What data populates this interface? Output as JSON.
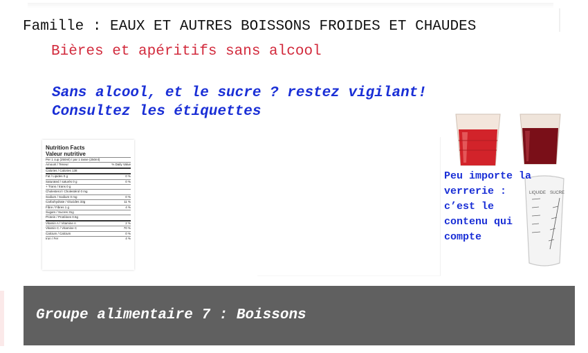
{
  "header": {
    "famille": "Famille : EAUX ET AUTRES BOISSONS FROIDES ET CHAUDES",
    "subtitle": "Bières et apéritifs sans alcool"
  },
  "warning": {
    "line1": "Sans alcool, et le sucre ? restez vigilant!",
    "line2": "Consultez les étiquettes"
  },
  "nutrition_label": {
    "title": "Nutrition Facts",
    "subtitle": "Valeur nutritive",
    "rows": [
      {
        "left": "Per 1 cup (250ml) / par 1 tasse (250ml)",
        "right": ""
      },
      {
        "left": "Amount / Teneur",
        "right": "% Daily Value"
      },
      {
        "left": "Calories / Calories 138",
        "right": ""
      },
      {
        "left": "Fat / Lipides 0 g",
        "right": "0 %"
      },
      {
        "left": "Saturated / saturés 0 g",
        "right": "0 %"
      },
      {
        "left": "+ Trans / trans 0 g",
        "right": ""
      },
      {
        "left": "Cholesterol / Cholestérol 0 mg",
        "right": ""
      },
      {
        "left": "Sodium / Sodium 0 mg",
        "right": "0 %"
      },
      {
        "left": "Carbohydrate / Glucides 33g",
        "right": "11 %"
      },
      {
        "left": "Fibre / Fibres 1 g",
        "right": "4 %"
      },
      {
        "left": "Sugars / Sucres 31g",
        "right": ""
      },
      {
        "left": "Protein / Protéines 0.5g",
        "right": ""
      },
      {
        "left": "Vitamin A / Vitamine A",
        "right": "2 %"
      },
      {
        "left": "Vitamin C / Vitamine C",
        "right": "70 %"
      },
      {
        "left": "Calcium / Calcium",
        "right": "0 %"
      },
      {
        "left": "Iron / Fer",
        "right": "4 %"
      }
    ]
  },
  "glass_note": {
    "lines": [
      "Peu importe la",
      "verrerie :",
      "c’est le",
      "contenu qui",
      "compte"
    ]
  },
  "beaker": {
    "label_left": "LIQUIDE",
    "label_right": "SUCRE"
  },
  "footer": {
    "text": "Groupe alimentaire 7 : Boissons"
  },
  "colors": {
    "title": "#111111",
    "subtitle_red": "#d22a3c",
    "accent_blue": "#1a2fd6",
    "footer_bg": "#606060",
    "footer_text": "#ffffff"
  },
  "icons": [
    "nutrition-label-image",
    "red-glass-icon",
    "dark-glass-icon",
    "measuring-beaker-icon"
  ]
}
